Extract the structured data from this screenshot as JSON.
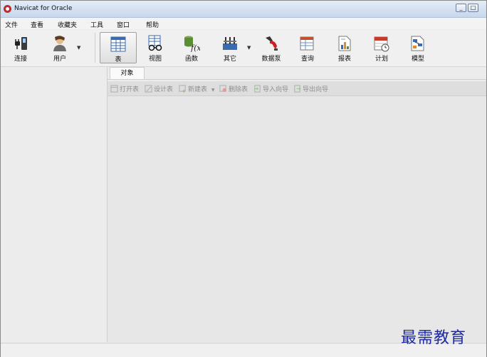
{
  "window": {
    "title": "Navicat for Oracle",
    "controls": [
      "_",
      "□"
    ]
  },
  "menu": [
    "文件",
    "查看",
    "收藏夹",
    "工具",
    "窗口",
    "帮助"
  ],
  "toolbar": [
    {
      "label": "连接",
      "icon": "plug-icon"
    },
    {
      "label": "用户",
      "icon": "user-icon"
    },
    {
      "label": "表",
      "icon": "table-icon",
      "active": true
    },
    {
      "label": "视图",
      "icon": "view-icon"
    },
    {
      "label": "函数",
      "icon": "function-icon"
    },
    {
      "label": "其它",
      "icon": "other-icon"
    },
    {
      "label": "数据泵",
      "icon": "data-pump-icon"
    },
    {
      "label": "查询",
      "icon": "query-icon"
    },
    {
      "label": "报表",
      "icon": "report-icon"
    },
    {
      "label": "计划",
      "icon": "schedule-icon"
    },
    {
      "label": "模型",
      "icon": "model-icon"
    }
  ],
  "tabs": {
    "objects": "对象"
  },
  "object_toolbar": [
    "打开表",
    "设计表",
    "新建表",
    "删除表",
    "导入向导",
    "导出向导"
  ],
  "watermark": "最需教育"
}
